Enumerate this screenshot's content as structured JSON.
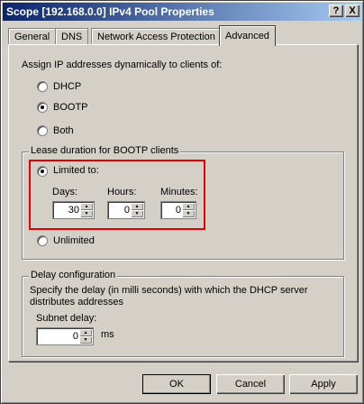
{
  "window": {
    "title": "Scope [192.168.0.0] IPv4 Pool Properties",
    "help_glyph": "?",
    "close_glyph": "X"
  },
  "tabs": [
    {
      "label": "General"
    },
    {
      "label": "DNS"
    },
    {
      "label": "Network Access Protection"
    },
    {
      "label": "Advanced"
    }
  ],
  "assign": {
    "heading": "Assign IP addresses dynamically to clients of:",
    "options": [
      {
        "label": "DHCP",
        "selected": false
      },
      {
        "label": "BOOTP",
        "selected": true
      },
      {
        "label": "Both",
        "selected": false
      }
    ]
  },
  "lease": {
    "group_title": "Lease duration for BOOTP clients",
    "limited_label": "Limited to:",
    "limited_selected": true,
    "days_label": "Days:",
    "days_value": "30",
    "hours_label": "Hours:",
    "hours_value": "0",
    "minutes_label": "Minutes:",
    "minutes_value": "0",
    "unlimited_label": "Unlimited",
    "unlimited_selected": false
  },
  "delay": {
    "group_title": "Delay configuration",
    "description": "Specify the delay (in milli seconds) with which the DHCP server distributes addresses",
    "subnet_label": "Subnet delay:",
    "subnet_value": "0",
    "unit": "ms"
  },
  "buttons": {
    "ok": "OK",
    "cancel": "Cancel",
    "apply": "Apply"
  },
  "colors": {
    "titlebar": "#0a246a",
    "highlight": "#e00000",
    "face": "#d4d0c8"
  }
}
